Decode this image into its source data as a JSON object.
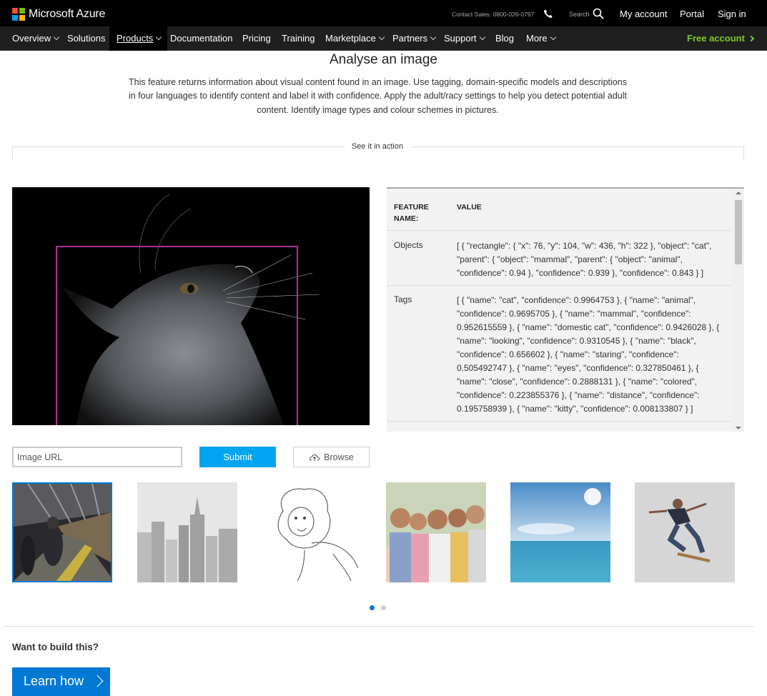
{
  "brand": {
    "name": "Microsoft Azure",
    "colors": [
      "#f25022",
      "#7fba00",
      "#00a4ef",
      "#ffb900"
    ]
  },
  "topbar": {
    "contact": "Contact Sales: 0800-026-0797",
    "search_label": "Search",
    "links": [
      "My account",
      "Portal",
      "Sign in"
    ]
  },
  "nav": {
    "items": [
      "Overview",
      "Solutions",
      "Products",
      "Documentation",
      "Pricing",
      "Training",
      "Marketplace",
      "Partners",
      "Support",
      "Blog",
      "More"
    ],
    "active": "Products",
    "free_account": "Free account"
  },
  "main": {
    "title": "Analyse an image",
    "description": "This feature returns information about visual content found in an image. Use tagging, domain-specific models and descriptions in four languages to identify content and label it with confidence. Apply the adult/racy settings to help you detect potential adult content. Identify image types and colour schemes in pictures.",
    "section_label": "See it in action"
  },
  "results": {
    "col_feature": "FEATURE NAME:",
    "col_value": "VALUE",
    "rows": [
      {
        "feature": "Objects",
        "value": "[ { \"rectangle\": { \"x\": 76, \"y\": 104, \"w\": 436, \"h\": 322 }, \"object\": \"cat\", \"parent\": { \"object\": \"mammal\", \"parent\": { \"object\": \"animal\", \"confidence\": 0.94 }, \"confidence\": 0.939 }, \"confidence\": 0.843 } ]"
      },
      {
        "feature": "Tags",
        "value": "[ { \"name\": \"cat\", \"confidence\": 0.9964753 }, { \"name\": \"animal\", \"confidence\": 0.9695705 }, { \"name\": \"mammal\", \"confidence\": 0.952615559 }, { \"name\": \"domestic cat\", \"confidence\": 0.9426028 }, { \"name\": \"looking\", \"confidence\": 0.9310545 }, { \"name\": \"black\", \"confidence\": 0.656602 }, { \"name\": \"staring\", \"confidence\": 0.505492747 }, { \"name\": \"eyes\", \"confidence\": 0.327850461 }, { \"name\": \"close\", \"confidence\": 0.2888131 }, { \"name\": \"colored\", \"confidence\": 0.223855376 }, { \"name\": \"distance\", \"confidence\": 0.195758939 }, { \"name\": \"kitty\", \"confidence\": 0.008133807 } ]"
      }
    ]
  },
  "form": {
    "url_placeholder": "Image URL",
    "submit_label": "Submit",
    "browse_label": "Browse"
  },
  "thumbnails": [
    "subway-platform",
    "city-skyline",
    "lion-drawing",
    "family-portrait",
    "ocean-sky",
    "skateboarder"
  ],
  "carousel": {
    "pages": 2,
    "current": 1,
    "active_color": "#0078d4",
    "inactive_color": "#ccc"
  },
  "footer": {
    "build_title": "Want to build this?",
    "learn_label": "Learn how"
  }
}
